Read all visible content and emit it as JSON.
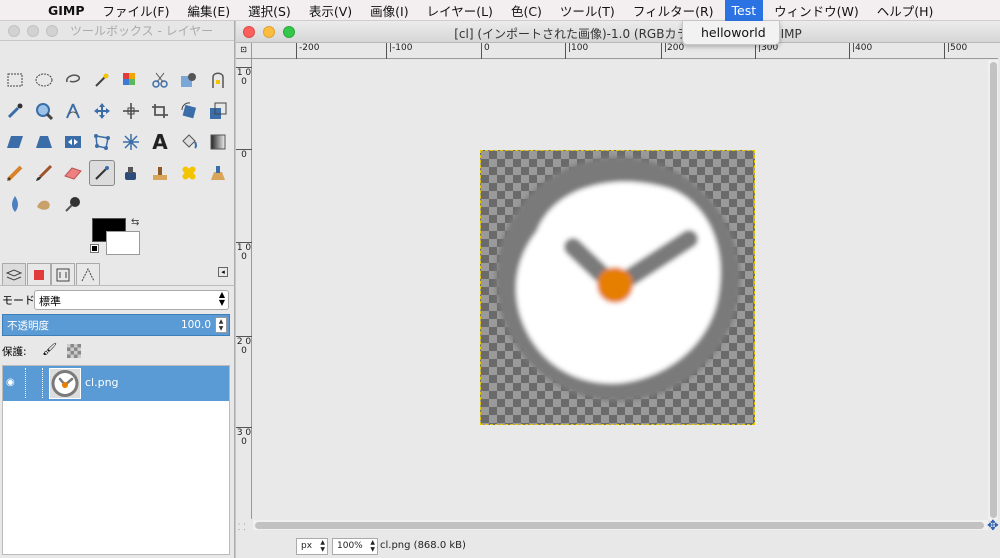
{
  "menubar": {
    "apple": "",
    "app": "GIMP",
    "items": [
      "ファイル(F)",
      "編集(E)",
      "選択(S)",
      "表示(V)",
      "画像(I)",
      "レイヤー(L)",
      "色(C)",
      "ツール(T)",
      "フィルター(R)",
      "Test",
      "ウィンドウ(W)",
      "ヘルプ(H)"
    ],
    "active_item": "Test",
    "dropdown": {
      "items": [
        "helloworld"
      ]
    }
  },
  "toolbox": {
    "title": "ツールボックス - レイヤー",
    "tools": [
      "rect-select",
      "ellipse-select",
      "free-select",
      "fuzzy-select",
      "by-color-select",
      "scissors",
      "foreground-select",
      "paths",
      "color-picker",
      "zoom",
      "measure",
      "move",
      "align",
      "crop",
      "rotate",
      "scale",
      "shear",
      "perspective",
      "flip",
      "cage",
      "unified-transform",
      "text",
      "bucket-fill",
      "blend",
      "pencil",
      "paintbrush",
      "eraser",
      "airbrush",
      "ink",
      "clone",
      "heal",
      "perspective-clone",
      "blur",
      "smudge",
      "dodge-burn"
    ],
    "fg_color": "#000000",
    "bg_color": "#ffffff",
    "mode_label": "モード:",
    "mode_value": "標準",
    "opacity_label": "不透明度",
    "opacity_value": "100.0",
    "lock_label": "保護:",
    "layer_name": "cl.png"
  },
  "image_window": {
    "title": "[cl] (インポートされた画像)-1.0 (RGBカラー, 1枚のレ                    ー GIMP",
    "hruler_ticks": [
      "-200",
      "|-100",
      "0",
      "|100",
      "|200",
      "|300",
      "|400",
      "|500"
    ],
    "vruler_ticks": [
      "1 0 0",
      "0",
      "1 0 0",
      "2 0 0",
      "3 0 0"
    ],
    "unit": "px",
    "zoom": "100%",
    "file_info": "cl.png (868.0 kB)"
  },
  "colors": {
    "accent": "#2b73e2",
    "selection": "#5b9bd5",
    "clock_hand": "#7a7a7a",
    "clock_center": "#e67e00"
  }
}
